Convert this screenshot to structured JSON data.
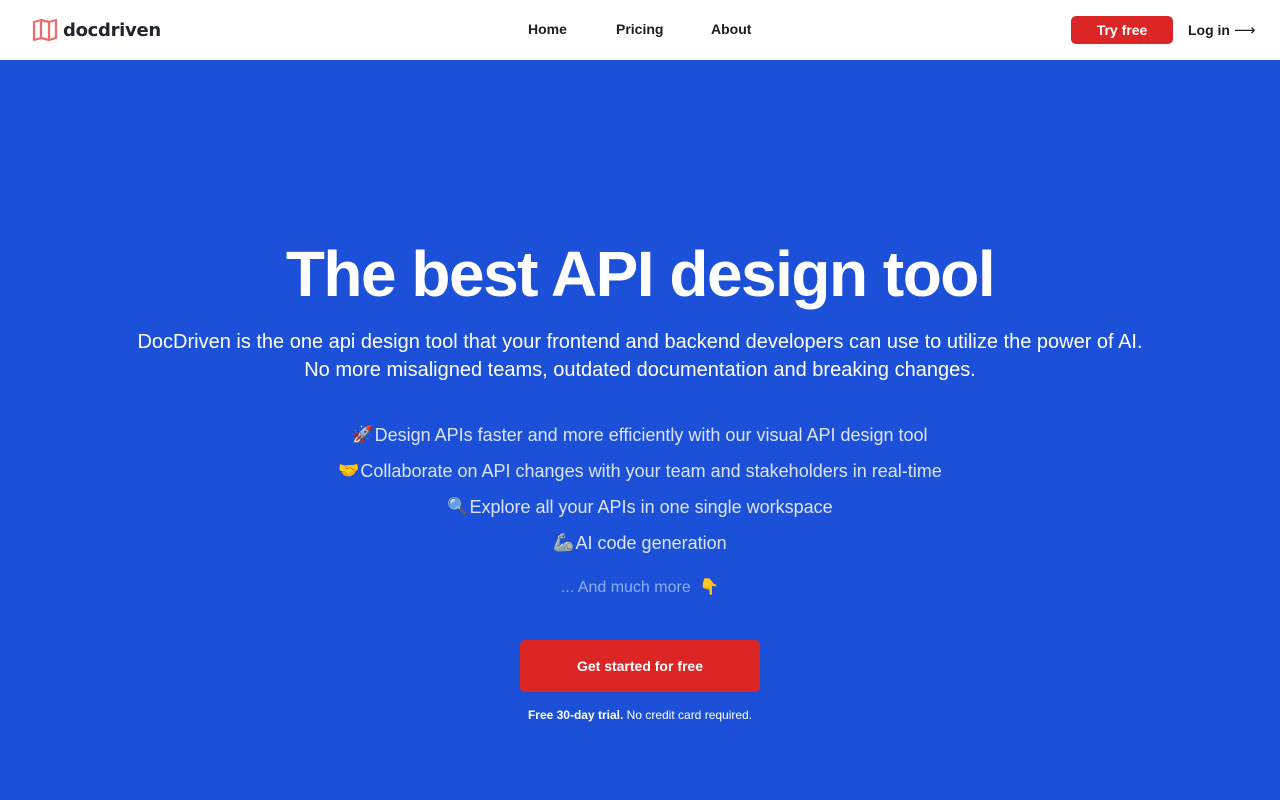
{
  "header": {
    "logo_text": "docdriven",
    "nav": [
      {
        "label": "Home"
      },
      {
        "label": "Pricing"
      },
      {
        "label": "About"
      }
    ],
    "try_free_label": "Try free",
    "login_label": "Log in",
    "login_arrow": "⟶"
  },
  "hero": {
    "title": "The best API design tool",
    "subtitle_line1": "DocDriven is the one api design tool that your frontend and backend developers can use to utilize the power of AI.",
    "subtitle_line2": "No more misaligned teams, outdated documentation and breaking changes.",
    "features": [
      {
        "emoji": "🚀",
        "text": "Design APIs faster and more efficiently with our visual API design tool"
      },
      {
        "emoji": "🤝",
        "text": "Collaborate on API changes with your team and stakeholders in real-time"
      },
      {
        "emoji": "🔍",
        "text": "Explore all your APIs in one single workspace"
      },
      {
        "emoji": "🦾",
        "text": "AI code generation"
      }
    ],
    "more_text": "... And much more",
    "more_emoji": "👇",
    "cta_label": "Get started for free",
    "trial_bold": "Free 30-day trial.",
    "trial_rest": " No credit card required."
  },
  "colors": {
    "hero_bg": "#1c50d9",
    "accent_red": "#dc2626",
    "header_bg": "#ffffff"
  }
}
